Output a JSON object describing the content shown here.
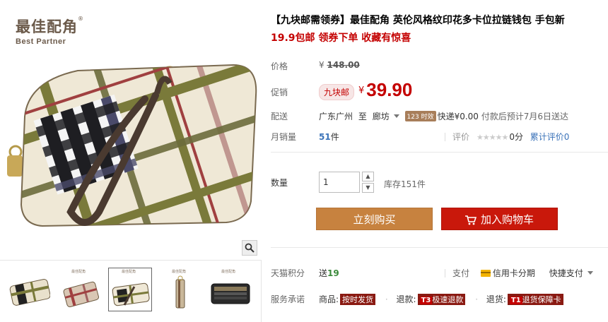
{
  "brand": {
    "name_cn": "最佳配角",
    "reg_mark": "®",
    "name_en": "Best Partner"
  },
  "product": {
    "title": "【九块邮需领券】最佳配角 英伦风格纹印花多卡位拉链钱包 手包新",
    "subtitle": "19.9包邮 领券下单 收藏有惊喜"
  },
  "labels": {
    "price": "价格",
    "promo": "促销",
    "delivery": "配送",
    "monthly_sales": "月销量",
    "rating": "评价",
    "quantity": "数量",
    "points": "天猫积分",
    "payment": "支付",
    "service": "服务承诺"
  },
  "price": {
    "currency": "¥",
    "original": "148.00",
    "promo_badge": "九块邮",
    "current": "39.90"
  },
  "delivery": {
    "from": "广东广州",
    "to_word": "至",
    "to": "廊坊",
    "time_badge": "123 时效",
    "express": "快递¥0.00",
    "eta": "付款后预计7月6日送达"
  },
  "sales": {
    "count": "51",
    "unit": "件"
  },
  "rating": {
    "stars": "★★★★★",
    "score": "0分",
    "link": "累计评价0"
  },
  "quantity": {
    "value": "1",
    "stock": "库存151件",
    "up": "▲",
    "down": "▼"
  },
  "buttons": {
    "buy_now": "立刻购买",
    "add_to_cart": "加入购物车"
  },
  "points": {
    "prefix": "送",
    "value": "19"
  },
  "payment": {
    "credit": "信用卡分期",
    "quick": "快捷支付"
  },
  "services": {
    "goods_prefix": "商品:",
    "goods_tag": "按时发货",
    "refund_prefix": "退款:",
    "refund_code": "T3",
    "refund_tag": "极速退款",
    "return_prefix": "退货:",
    "return_code": "T1",
    "return_tag": "退货保障卡"
  },
  "thumb_logo": "最佳配角",
  "colors": {
    "accent_red": "#c40000",
    "buy_button": "#c7823f",
    "cart_button": "#c9180b"
  }
}
